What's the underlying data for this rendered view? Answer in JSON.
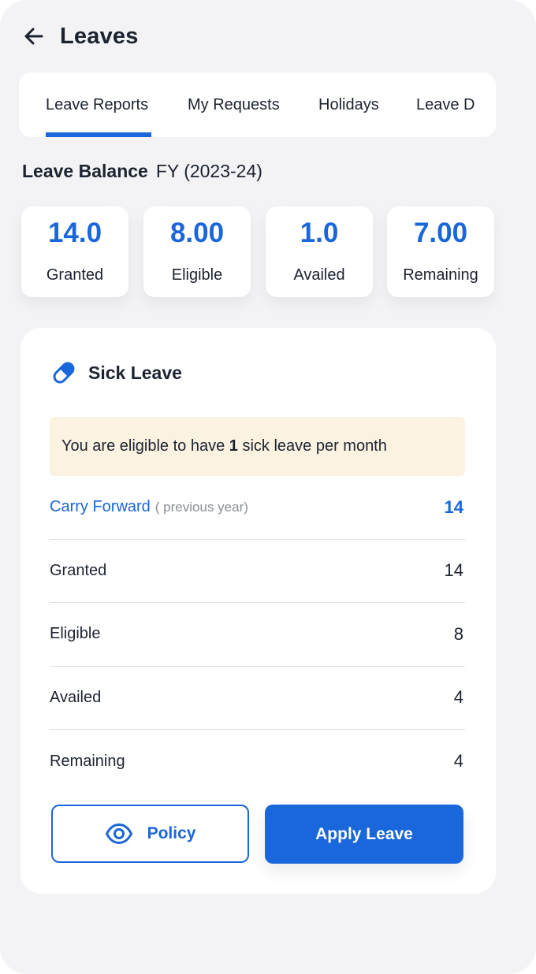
{
  "header": {
    "title": "Leaves",
    "back_icon": "arrow-left-icon"
  },
  "tabs": [
    {
      "label": "Leave Reports",
      "active": true
    },
    {
      "label": "My Requests",
      "active": false
    },
    {
      "label": "Holidays",
      "active": false
    },
    {
      "label": "Leave Details",
      "active": false
    }
  ],
  "balance": {
    "heading": "Leave Balance",
    "period": "FY (2023-24)",
    "stats": [
      {
        "value": "14.0",
        "label": "Granted"
      },
      {
        "value": "8.00",
        "label": "Eligible"
      },
      {
        "value": "1.0",
        "label": "Availed"
      },
      {
        "value": "7.00",
        "label": "Remaining"
      }
    ]
  },
  "leave_card": {
    "icon": "pill-icon",
    "title": "Sick Leave",
    "notice": {
      "prefix": "You are eligible to have ",
      "count": "1",
      "suffix": " sick leave per month"
    },
    "rows": [
      {
        "label": "Carry Forward",
        "sub": "( previous year)",
        "value": "14",
        "highlight": true
      },
      {
        "label": "Granted",
        "value": "14"
      },
      {
        "label": "Eligible",
        "value": "8"
      },
      {
        "label": "Availed",
        "value": "4"
      },
      {
        "label": "Remaining",
        "value": "4"
      }
    ],
    "policy_button": {
      "label": "Policy",
      "icon": "eye-icon"
    },
    "apply_button": {
      "label": "Apply Leave"
    }
  },
  "colors": {
    "accent": "#1a66db",
    "background": "#f3f3f5",
    "notice_bg": "#fbf2e2",
    "text": "#1c2330",
    "muted": "#8a8f97"
  }
}
